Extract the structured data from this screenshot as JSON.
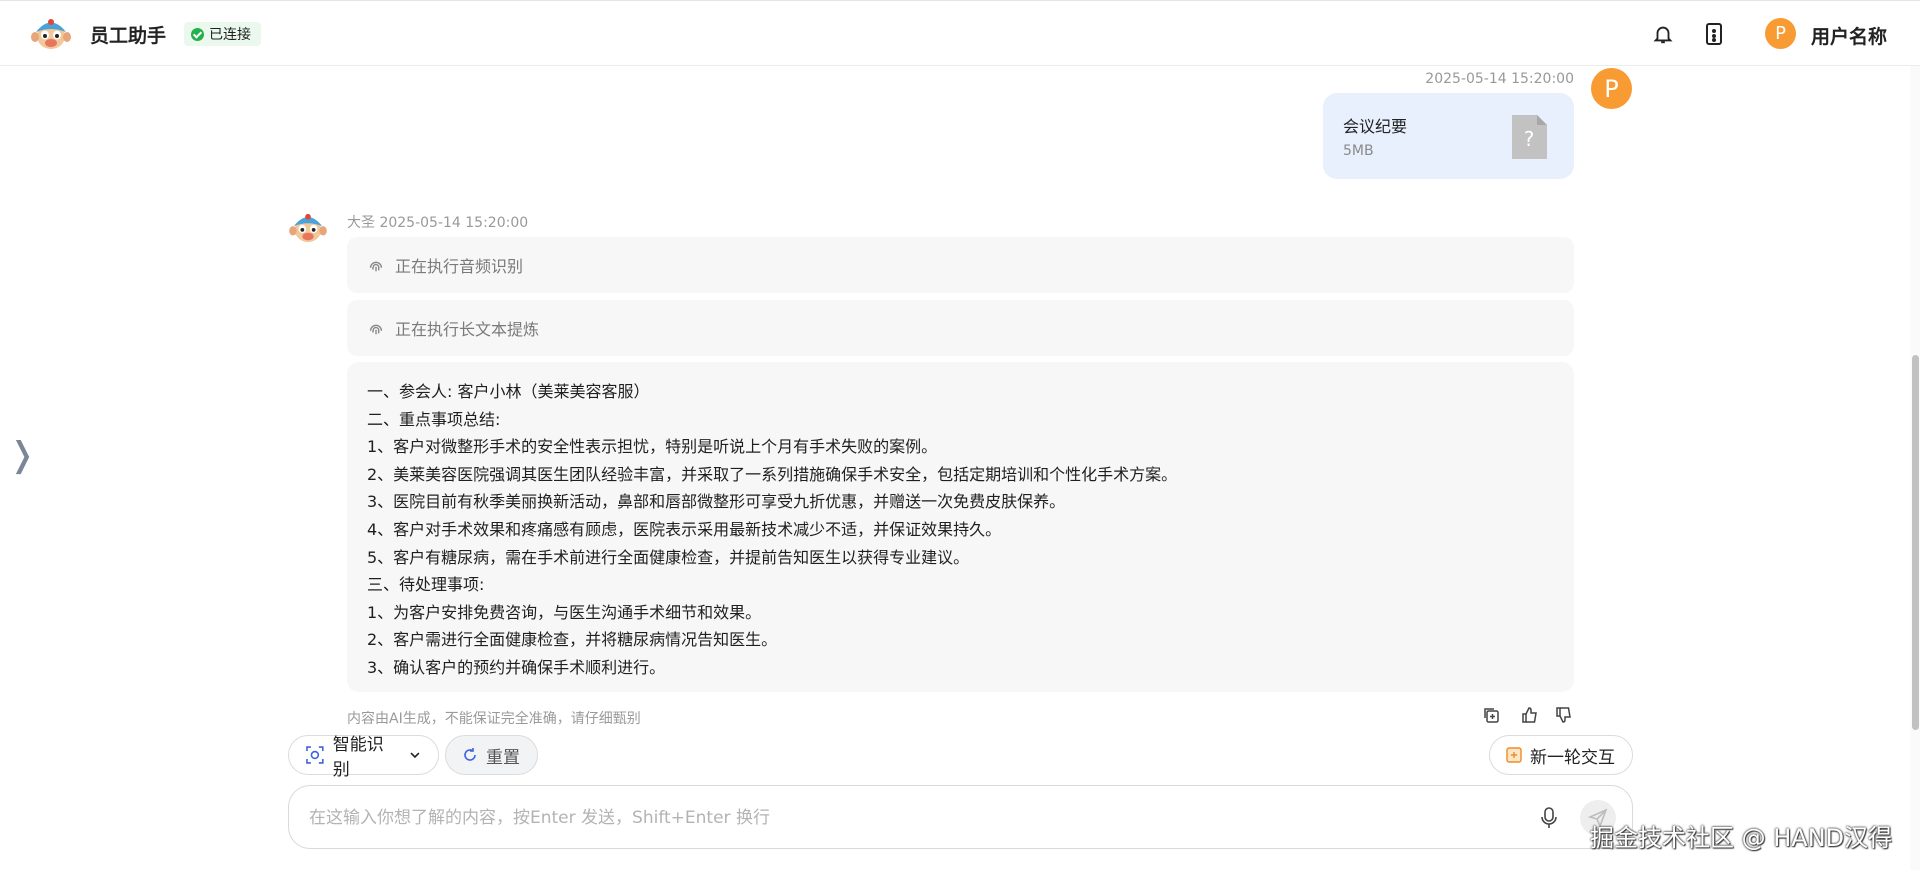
{
  "header": {
    "app_title": "员工助手",
    "status": "已连接",
    "status_color": "#23b14d",
    "user_avatar_letter": "P",
    "user_name": "用户名称",
    "icons": [
      "bell-icon",
      "phone-icon"
    ]
  },
  "conversation": {
    "user_message": {
      "time": "2025-05-14 15:20:00",
      "avatar_letter": "P",
      "file": {
        "name": "会议纪要",
        "size": "5MB",
        "icon": "unknown-file-icon"
      }
    },
    "assistant_message": {
      "name": "大圣",
      "time": "2025-05-14 15:20:00",
      "steps": [
        "正在执行音频识别",
        "正在执行长文本提炼"
      ],
      "lines": [
        "一、参会人: 客户小林（美莱美容客服）",
        "二、重点事项总结:",
        "1、客户对微整形手术的安全性表示担忧，特别是听说上个月有手术失败的案例。",
        "2、美莱美容医院强调其医生团队经验丰富，并采取了一系列措施确保手术安全，包括定期培训和个性化手术方案。",
        "3、医院目前有秋季美丽换新活动，鼻部和唇部微整形可享受九折优惠，并赠送一次免费皮肤保养。",
        "4、客户对手术效果和疼痛感有顾虑，医院表示采用最新技术减少不适，并保证效果持久。",
        "5、客户有糖尿病，需在手术前进行全面健康检查，并提前告知医生以获得专业建议。",
        "三、待处理事项:",
        "1、为客户安排免费咨询，与医生沟通手术细节和效果。",
        "2、客户需进行全面健康检查，并将糖尿病情况告知医生。",
        "3、确认客户的预约并确保手术顺利进行。"
      ],
      "disclaimer": "内容由AI生成，不能保证完全准确，请仔细甄别"
    }
  },
  "toolbar": {
    "smart_recognition": "智能识别",
    "reset": "重置",
    "new_round": "新一轮交互"
  },
  "input": {
    "placeholder": "在这输入你想了解的内容，按Enter 发送，Shift+Enter 换行",
    "value": ""
  },
  "watermark": "掘金技术社区 @ HAND汉得",
  "colors": {
    "accent": "#f79b32",
    "user_bubble": "#e8effd",
    "bot_bubble": "#f7f7f7"
  }
}
